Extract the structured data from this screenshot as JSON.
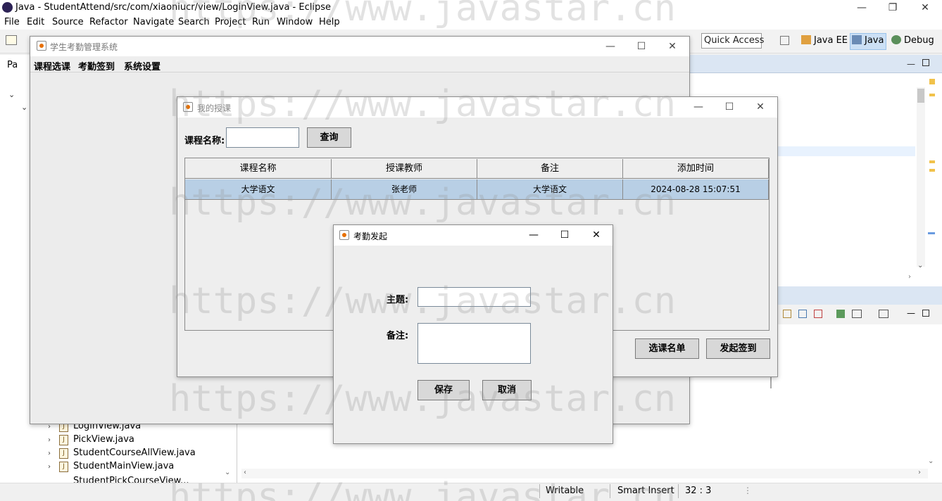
{
  "eclipse": {
    "title": "Java - StudentAttend/src/com/xiaoniucr/view/LoginView.java - Eclipse",
    "menu": [
      "File",
      "Edit",
      "Source",
      "Refactor",
      "Navigate",
      "Search",
      "Project",
      "Run",
      "Window",
      "Help"
    ],
    "quick_access": "Quick Access",
    "perspectives": [
      "Java EE",
      "Java",
      "Debug"
    ],
    "package_tab_stub": "Pa",
    "tree_files": [
      "LoginView.java",
      "PickView.java",
      "StudentCourseAllView.java",
      "StudentMainView.java",
      "StudentPickCourseView..."
    ],
    "status": {
      "mode": "Writable",
      "insert": "Smart Insert",
      "position": "32 : 3"
    }
  },
  "main_window": {
    "title": "学生考勤管理系统",
    "menus": [
      "课程选课",
      "考勤签到",
      "系统设置"
    ]
  },
  "courses_window": {
    "title": "我的授课",
    "search_label": "课程名称:",
    "search_value": "",
    "query_button": "查询",
    "columns": [
      "课程名称",
      "授课教师",
      "备注",
      "添加时间"
    ],
    "rows": [
      [
        "大学语文",
        "张老师",
        "大学语文",
        "2024-08-28 15:07:51"
      ]
    ],
    "list_button": "选课名单",
    "start_button": "发起签到"
  },
  "dialog": {
    "title": "考勤发起",
    "subject_label": "主题:",
    "subject_value": "",
    "note_label": "备注:",
    "note_value": "",
    "save_button": "保存",
    "cancel_button": "取消"
  },
  "watermark": "https://www.javastar.cn"
}
